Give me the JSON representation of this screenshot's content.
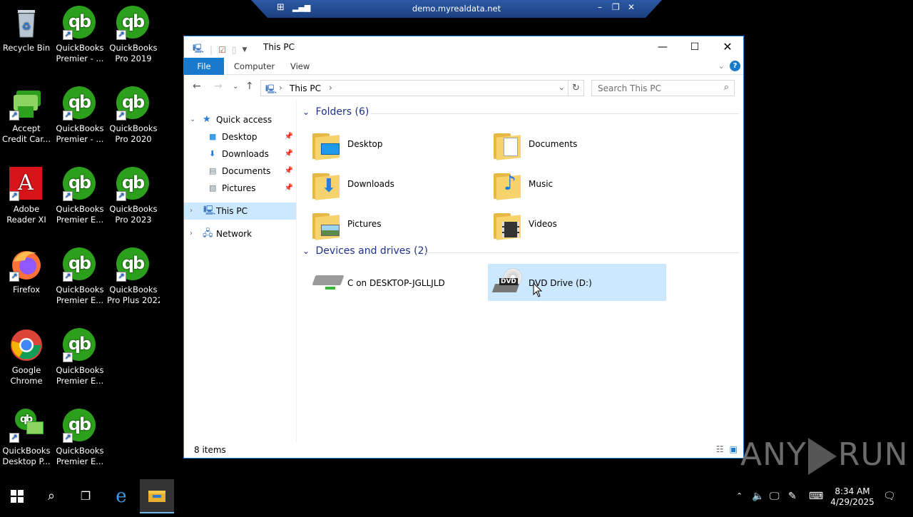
{
  "desktop": {
    "icons": [
      {
        "l1": "Recycle Bin",
        "l2": ""
      },
      {
        "l1": "QuickBooks",
        "l2": "Premier - ..."
      },
      {
        "l1": "QuickBooks",
        "l2": "Pro 2019"
      },
      {
        "l1": "Accept",
        "l2": "Credit Car..."
      },
      {
        "l1": "QuickBooks",
        "l2": "Premier - ..."
      },
      {
        "l1": "QuickBooks",
        "l2": "Pro 2020"
      },
      {
        "l1": "Adobe",
        "l2": "Reader XI"
      },
      {
        "l1": "QuickBooks",
        "l2": "Premier E..."
      },
      {
        "l1": "QuickBooks",
        "l2": "Pro 2023"
      },
      {
        "l1": "Firefox",
        "l2": ""
      },
      {
        "l1": "QuickBooks",
        "l2": "Premier E..."
      },
      {
        "l1": "QuickBooks",
        "l2": "Pro Plus 2022"
      },
      {
        "l1": "Google",
        "l2": "Chrome"
      },
      {
        "l1": "QuickBooks",
        "l2": "Premier E..."
      },
      {
        "l1": "QuickBooks",
        "l2": "Desktop P..."
      },
      {
        "l1": "QuickBooks",
        "l2": "Premier E..."
      }
    ],
    "qb_glyph": "qb",
    "adobe_glyph": "A"
  },
  "remote_bar": {
    "title": "demo.myrealdata.net"
  },
  "explorer": {
    "title": "This PC",
    "ribbon_tabs": {
      "file": "File",
      "computer": "Computer",
      "view": "View"
    },
    "help": "?",
    "address": {
      "crumb": "This PC"
    },
    "search_placeholder": "Search This PC",
    "nav": {
      "quick_access": "Quick access",
      "desktop": "Desktop",
      "downloads": "Downloads",
      "documents": "Documents",
      "pictures": "Pictures",
      "this_pc": "This PC",
      "network": "Network"
    },
    "folders_header": "Folders (6)",
    "folders": [
      "Desktop",
      "Documents",
      "Downloads",
      "Music",
      "Pictures",
      "Videos"
    ],
    "devices_header": "Devices and drives (2)",
    "drives": [
      "C on DESKTOP-JGLLJLD",
      "DVD Drive (D:)"
    ],
    "dvd_label": "DVD",
    "status": "8 items"
  },
  "taskbar": {
    "time": "8:34 AM",
    "date": "4/29/2025"
  },
  "watermark": {
    "left": "ANY",
    "right": "RUN"
  }
}
